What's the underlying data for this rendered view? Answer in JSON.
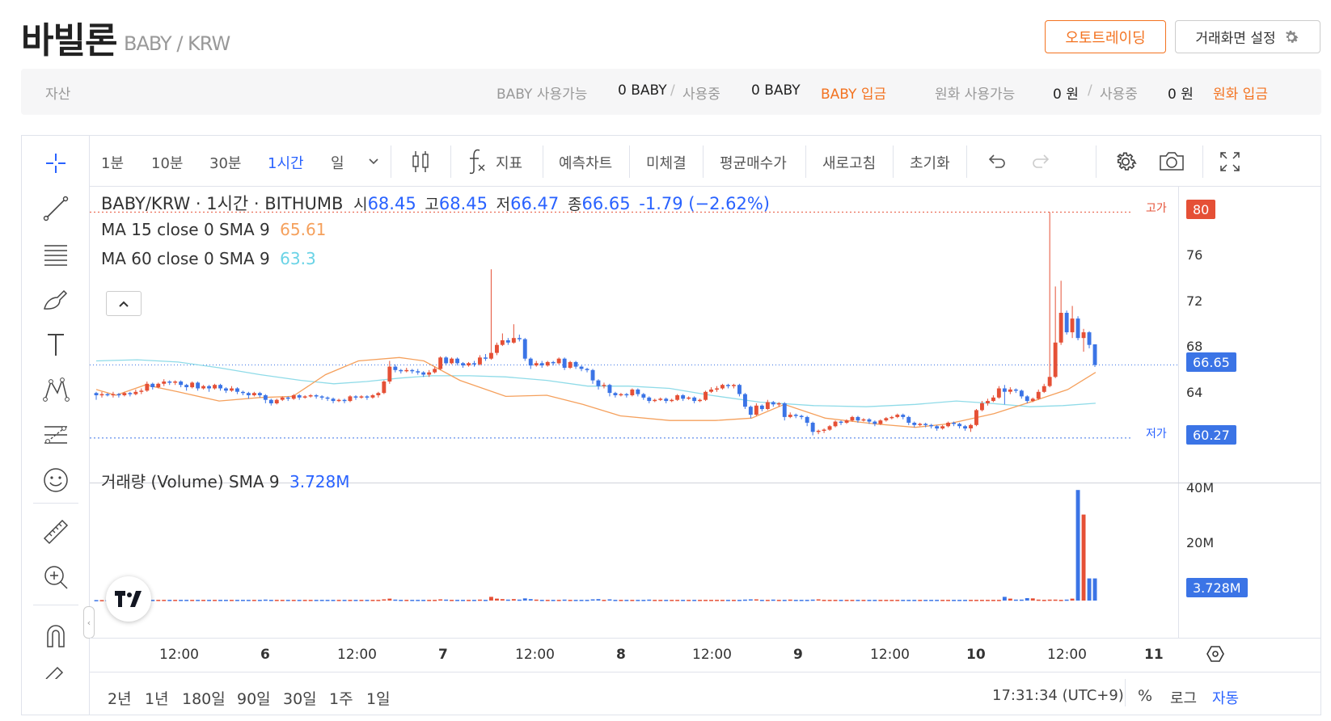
{
  "header": {
    "coin_name": "바빌론",
    "pair": "BABY / KRW",
    "auto_trading_label": "오토트레이딩",
    "screen_settings_label": "거래화면 설정"
  },
  "assets": {
    "label": "자산",
    "coin_available_label": "BABY 사용가능",
    "coin_available_value": "0 BABY",
    "in_use_label": "사용중",
    "coin_in_use_value": "0 BABY",
    "coin_deposit_link": "BABY 입금",
    "krw_available_label": "원화 사용가능",
    "krw_available_value": "0 원",
    "krw_in_use_value": "0 원",
    "krw_deposit_link": "원화 입금"
  },
  "toolbar": {
    "intervals": [
      "1분",
      "10분",
      "30분",
      "1시간",
      "일"
    ],
    "active_interval": "1시간",
    "indicators_label": "지표",
    "forecast_label": "예측차트",
    "unfilled_label": "미체결",
    "avg_price_label": "평균매수가",
    "refresh_label": "새로고침",
    "reset_label": "초기화"
  },
  "legend": {
    "main_title": "BABY/KRW · 1시간 · BITHUMB",
    "o_label": "시",
    "o_value": "68.45",
    "h_label": "고",
    "h_value": "68.45",
    "l_label": "저",
    "l_value": "66.47",
    "c_label": "종",
    "c_value": "66.65",
    "change": "-1.79 (−2.62%)",
    "ma15_label": "MA 15 close 0 SMA 9",
    "ma15_value": "65.61",
    "ma60_label": "MA 60 close 0 SMA 9",
    "ma60_value": "63.3",
    "volume_label": "거래량 (Volume) SMA 9",
    "volume_value": "3.728M"
  },
  "price_axis": {
    "ticks": [
      "76",
      "72",
      "68",
      "64"
    ],
    "high_label": "고가",
    "high_value": "80",
    "low_label": "저가",
    "low_value": "60.27",
    "last_value": "66.65"
  },
  "volume_axis": {
    "ticks": [
      "40M",
      "20M"
    ],
    "last_value": "3.728M"
  },
  "time_axis": {
    "ticks": [
      "12:00",
      "6",
      "12:00",
      "7",
      "12:00",
      "8",
      "12:00",
      "9",
      "12:00",
      "10",
      "12:00",
      "11"
    ]
  },
  "bottom_bar": {
    "ranges": [
      "2년",
      "1년",
      "180일",
      "90일",
      "30일",
      "1주",
      "1일"
    ],
    "clock": "17:31:34 (UTC+9)",
    "percent_label": "%",
    "log_label": "로그",
    "auto_label": "자동"
  },
  "colors": {
    "up": "#e55036",
    "down": "#3b74e6",
    "accent": "#f37321",
    "ma15": "#f5a05c",
    "ma60": "#8fdbe8"
  },
  "chart_data": {
    "type": "candlestick",
    "interval": "1h",
    "x_ticks": [
      "12:00",
      "6",
      "12:00",
      "7",
      "12:00",
      "8",
      "12:00",
      "9",
      "12:00",
      "10",
      "12:00",
      "11"
    ],
    "price_range": [
      58,
      82
    ],
    "volume_range": [
      0,
      50
    ],
    "volume_unit": "M",
    "candles": [
      [
        64.2,
        64.0,
        63.6,
        64.3
      ],
      [
        64.0,
        64.1,
        63.8,
        64.3
      ],
      [
        64.1,
        64.0,
        63.9,
        64.2
      ],
      [
        64.0,
        64.1,
        63.8,
        64.3
      ],
      [
        64.1,
        64.0,
        63.8,
        64.2
      ],
      [
        64.0,
        64.2,
        63.9,
        64.3
      ],
      [
        64.2,
        64.1,
        63.9,
        64.3
      ],
      [
        64.1,
        64.3,
        64.0,
        64.5
      ],
      [
        64.3,
        64.4,
        64.1,
        64.6
      ],
      [
        64.4,
        65.0,
        64.3,
        65.2
      ],
      [
        65.0,
        64.7,
        64.5,
        65.1
      ],
      [
        64.7,
        65.0,
        64.6,
        65.1
      ],
      [
        65.0,
        65.2,
        64.8,
        65.4
      ],
      [
        65.2,
        65.1,
        64.9,
        65.3
      ],
      [
        65.1,
        65.2,
        64.9,
        65.3
      ],
      [
        65.2,
        64.9,
        64.7,
        65.3
      ],
      [
        64.9,
        64.7,
        64.4,
        65.0
      ],
      [
        64.7,
        65.1,
        64.6,
        65.2
      ],
      [
        65.1,
        64.6,
        64.4,
        65.2
      ],
      [
        64.6,
        64.8,
        64.5,
        64.9
      ],
      [
        64.8,
        64.6,
        64.3,
        64.9
      ],
      [
        64.6,
        64.9,
        64.5,
        65.0
      ],
      [
        64.9,
        64.6,
        64.4,
        65.0
      ],
      [
        64.6,
        64.4,
        64.2,
        64.7
      ],
      [
        64.4,
        64.6,
        64.3,
        64.8
      ],
      [
        64.6,
        64.3,
        64.1,
        64.7
      ],
      [
        64.3,
        64.2,
        64.0,
        64.4
      ],
      [
        64.2,
        64.0,
        63.7,
        64.3
      ],
      [
        64.0,
        64.2,
        63.9,
        64.3
      ],
      [
        64.2,
        64.0,
        63.8,
        64.3
      ],
      [
        64.0,
        63.6,
        63.3,
        64.1
      ],
      [
        63.6,
        63.3,
        63.1,
        63.7
      ],
      [
        63.3,
        63.6,
        63.2,
        63.7
      ],
      [
        63.6,
        63.8,
        63.5,
        63.9
      ],
      [
        63.8,
        63.7,
        63.5,
        63.9
      ],
      [
        63.7,
        64.0,
        63.6,
        64.1
      ],
      [
        64.0,
        63.8,
        63.6,
        64.1
      ],
      [
        63.8,
        63.9,
        63.7,
        64.0
      ],
      [
        63.9,
        64.0,
        63.8,
        64.1
      ],
      [
        64.0,
        63.9,
        63.7,
        64.1
      ],
      [
        63.9,
        63.8,
        63.6,
        64.0
      ],
      [
        63.8,
        63.7,
        63.5,
        63.9
      ],
      [
        63.7,
        63.5,
        63.3,
        63.8
      ],
      [
        63.5,
        63.6,
        63.4,
        63.7
      ],
      [
        63.6,
        63.5,
        63.3,
        63.7
      ],
      [
        63.5,
        63.9,
        63.4,
        64.0
      ],
      [
        63.9,
        63.8,
        63.6,
        64.0
      ],
      [
        63.8,
        63.9,
        63.7,
        64.0
      ],
      [
        63.9,
        63.8,
        63.6,
        64.0
      ],
      [
        63.8,
        64.0,
        63.7,
        64.1
      ],
      [
        64.0,
        64.2,
        63.8,
        64.3
      ],
      [
        64.2,
        65.2,
        64.1,
        65.3
      ],
      [
        65.2,
        66.5,
        65.0,
        67.0
      ],
      [
        66.5,
        66.2,
        66.0,
        66.7
      ],
      [
        66.2,
        66.1,
        65.9,
        66.3
      ],
      [
        66.1,
        66.2,
        66.0,
        66.4
      ],
      [
        66.2,
        66.1,
        65.9,
        66.3
      ],
      [
        66.1,
        66.0,
        65.8,
        66.3
      ],
      [
        66.0,
        65.8,
        65.6,
        66.1
      ],
      [
        65.8,
        66.0,
        65.6,
        66.2
      ],
      [
        66.0,
        66.3,
        65.9,
        66.5
      ],
      [
        66.3,
        67.3,
        66.2,
        67.4
      ],
      [
        67.3,
        66.8,
        66.6,
        67.4
      ],
      [
        66.8,
        67.2,
        66.7,
        67.3
      ],
      [
        67.2,
        66.8,
        66.6,
        67.3
      ],
      [
        66.8,
        66.6,
        66.4,
        66.9
      ],
      [
        66.6,
        66.8,
        66.5,
        66.9
      ],
      [
        66.8,
        66.7,
        66.5,
        67.0
      ],
      [
        66.7,
        67.3,
        66.6,
        67.5
      ],
      [
        67.3,
        67.2,
        67.0,
        67.6
      ],
      [
        67.2,
        67.7,
        67.1,
        75.0
      ],
      [
        67.7,
        68.4,
        67.5,
        68.6
      ],
      [
        68.4,
        68.8,
        68.3,
        69.4
      ],
      [
        68.8,
        68.6,
        68.4,
        69.0
      ],
      [
        68.6,
        69.0,
        68.5,
        70.2
      ],
      [
        69.0,
        68.9,
        68.7,
        69.3
      ],
      [
        68.9,
        67.2,
        67.0,
        69.0
      ],
      [
        67.2,
        66.6,
        66.3,
        67.3
      ],
      [
        66.6,
        66.8,
        66.5,
        67.0
      ],
      [
        66.8,
        66.6,
        66.4,
        67.0
      ],
      [
        66.6,
        66.9,
        66.5,
        67.0
      ],
      [
        66.9,
        66.8,
        66.6,
        67.0
      ],
      [
        66.8,
        67.2,
        66.7,
        67.3
      ],
      [
        67.2,
        66.4,
        66.2,
        67.3
      ],
      [
        66.4,
        66.9,
        66.3,
        67.0
      ],
      [
        66.9,
        66.5,
        66.3,
        67.0
      ],
      [
        66.5,
        66.3,
        66.1,
        66.6
      ],
      [
        66.3,
        66.2,
        66.0,
        66.4
      ],
      [
        66.2,
        65.3,
        65.0,
        66.3
      ],
      [
        65.3,
        64.8,
        64.5,
        65.4
      ],
      [
        64.8,
        64.9,
        64.6,
        65.1
      ],
      [
        64.9,
        64.2,
        63.9,
        65.0
      ],
      [
        64.2,
        64.0,
        63.8,
        64.3
      ],
      [
        64.0,
        64.1,
        63.9,
        64.2
      ],
      [
        64.1,
        64.0,
        63.8,
        64.2
      ],
      [
        64.0,
        64.5,
        63.9,
        64.6
      ],
      [
        64.5,
        64.1,
        63.9,
        64.6
      ],
      [
        64.1,
        63.8,
        63.6,
        64.2
      ],
      [
        63.8,
        63.5,
        63.3,
        63.9
      ],
      [
        63.5,
        63.6,
        63.4,
        63.7
      ],
      [
        63.6,
        63.7,
        63.5,
        63.8
      ],
      [
        63.7,
        63.5,
        63.3,
        63.8
      ],
      [
        63.5,
        63.6,
        63.4,
        63.7
      ],
      [
        63.6,
        64.0,
        63.5,
        64.1
      ],
      [
        64.0,
        63.7,
        63.5,
        64.1
      ],
      [
        63.7,
        63.8,
        63.6,
        63.9
      ],
      [
        63.8,
        63.5,
        63.3,
        63.9
      ],
      [
        63.5,
        63.6,
        63.4,
        63.7
      ],
      [
        63.6,
        64.3,
        63.5,
        64.4
      ],
      [
        64.3,
        64.5,
        64.2,
        64.7
      ],
      [
        64.5,
        64.6,
        64.3,
        64.8
      ],
      [
        64.6,
        64.9,
        64.5,
        65.0
      ],
      [
        64.9,
        64.8,
        64.6,
        65.0
      ],
      [
        64.8,
        64.9,
        64.6,
        65.0
      ],
      [
        64.9,
        64.1,
        63.9,
        65.0
      ],
      [
        64.1,
        63.0,
        62.8,
        64.2
      ],
      [
        63.0,
        62.3,
        62.0,
        63.1
      ],
      [
        62.3,
        63.1,
        62.2,
        63.3
      ],
      [
        63.1,
        62.8,
        62.6,
        63.2
      ],
      [
        62.8,
        63.4,
        62.7,
        63.6
      ],
      [
        63.4,
        63.2,
        63.0,
        63.5
      ],
      [
        63.2,
        63.3,
        63.0,
        63.4
      ],
      [
        63.3,
        62.1,
        61.8,
        63.4
      ],
      [
        62.1,
        62.3,
        62.0,
        62.5
      ],
      [
        62.3,
        62.2,
        62.0,
        62.4
      ],
      [
        62.2,
        62.1,
        61.9,
        62.3
      ],
      [
        62.1,
        61.6,
        61.3,
        62.2
      ],
      [
        61.6,
        60.8,
        60.5,
        61.7
      ],
      [
        60.8,
        60.9,
        60.6,
        61.0
      ],
      [
        60.9,
        61.0,
        60.7,
        61.1
      ],
      [
        61.0,
        61.3,
        60.9,
        61.4
      ],
      [
        61.3,
        61.7,
        61.2,
        61.8
      ],
      [
        61.7,
        61.6,
        61.4,
        61.8
      ],
      [
        61.6,
        61.8,
        61.5,
        61.9
      ],
      [
        61.8,
        62.1,
        61.7,
        62.2
      ],
      [
        62.1,
        61.8,
        61.6,
        62.2
      ],
      [
        61.8,
        61.9,
        61.7,
        62.0
      ],
      [
        61.9,
        61.7,
        61.5,
        62.0
      ],
      [
        61.7,
        61.5,
        61.3,
        61.8
      ],
      [
        61.5,
        61.8,
        61.4,
        61.9
      ],
      [
        61.8,
        62.0,
        61.7,
        62.1
      ],
      [
        62.0,
        62.1,
        61.9,
        62.2
      ],
      [
        62.1,
        62.3,
        62.0,
        62.4
      ],
      [
        62.3,
        62.1,
        61.9,
        62.4
      ],
      [
        62.1,
        61.6,
        61.4,
        62.2
      ],
      [
        61.6,
        61.4,
        61.2,
        61.7
      ],
      [
        61.4,
        61.5,
        61.3,
        61.6
      ],
      [
        61.5,
        61.4,
        61.2,
        61.6
      ],
      [
        61.4,
        61.3,
        61.1,
        61.5
      ],
      [
        61.3,
        61.1,
        60.9,
        61.4
      ],
      [
        61.1,
        61.3,
        61.0,
        61.4
      ],
      [
        61.3,
        61.6,
        61.2,
        61.7
      ],
      [
        61.6,
        61.5,
        61.3,
        61.7
      ],
      [
        61.5,
        61.3,
        61.1,
        61.6
      ],
      [
        61.3,
        61.1,
        60.9,
        61.4
      ],
      [
        61.1,
        61.4,
        60.8,
        61.5
      ],
      [
        61.4,
        62.7,
        61.3,
        62.8
      ],
      [
        62.7,
        63.3,
        62.6,
        63.5
      ],
      [
        63.3,
        63.5,
        63.1,
        63.7
      ],
      [
        63.5,
        63.8,
        63.4,
        64.0
      ],
      [
        63.8,
        64.6,
        63.7,
        64.8
      ],
      [
        64.6,
        64.3,
        63.2,
        64.9
      ],
      [
        64.3,
        64.5,
        64.1,
        64.7
      ],
      [
        64.5,
        64.4,
        64.2,
        64.6
      ],
      [
        64.4,
        63.9,
        63.7,
        64.5
      ],
      [
        63.9,
        63.5,
        63.3,
        64.0
      ],
      [
        63.5,
        63.7,
        63.4,
        63.8
      ],
      [
        63.7,
        64.3,
        63.6,
        64.5
      ],
      [
        64.3,
        64.8,
        64.2,
        65.0
      ],
      [
        64.8,
        65.6,
        64.7,
        80.0
      ],
      [
        65.6,
        68.6,
        65.5,
        73.5
      ],
      [
        68.6,
        71.2,
        68.4,
        74.0
      ],
      [
        71.2,
        69.5,
        69.3,
        71.4
      ],
      [
        69.5,
        70.7,
        69.0,
        71.8
      ],
      [
        70.7,
        69.0,
        68.8,
        70.9
      ],
      [
        69.0,
        69.5,
        67.8,
        69.8
      ],
      [
        69.5,
        68.4,
        68.1,
        69.6
      ],
      [
        68.45,
        66.65,
        66.47,
        68.45
      ]
    ],
    "volumes_M": [
      0.2,
      0.2,
      0.2,
      0.2,
      0.2,
      0.2,
      0.2,
      0.2,
      0.3,
      0.4,
      0.3,
      0.3,
      0.3,
      0.3,
      0.3,
      0.3,
      0.3,
      0.3,
      0.3,
      0.3,
      0.3,
      0.3,
      0.3,
      0.3,
      0.3,
      0.3,
      0.3,
      0.3,
      0.3,
      0.3,
      0.4,
      0.3,
      0.3,
      0.3,
      0.3,
      0.3,
      0.3,
      0.3,
      0.3,
      0.3,
      0.3,
      0.3,
      0.3,
      0.3,
      0.3,
      0.3,
      0.3,
      0.3,
      0.3,
      0.3,
      0.3,
      0.5,
      0.8,
      0.4,
      0.3,
      0.3,
      0.3,
      0.3,
      0.3,
      0.3,
      0.3,
      0.5,
      0.4,
      0.3,
      0.3,
      0.3,
      0.3,
      0.3,
      0.4,
      0.3,
      1.5,
      0.8,
      0.6,
      0.4,
      0.6,
      0.4,
      0.9,
      0.6,
      0.4,
      0.3,
      0.3,
      0.3,
      0.3,
      0.4,
      0.3,
      0.3,
      0.3,
      0.3,
      0.5,
      0.6,
      0.3,
      0.5,
      0.3,
      0.3,
      0.3,
      0.3,
      0.3,
      0.3,
      0.4,
      0.3,
      0.3,
      0.3,
      0.3,
      0.3,
      0.3,
      0.3,
      0.3,
      0.3,
      0.3,
      0.3,
      0.3,
      0.3,
      0.3,
      0.3,
      0.3,
      0.4,
      0.5,
      0.5,
      0.3,
      0.3,
      0.4,
      0.3,
      0.3,
      0.4,
      0.3,
      0.3,
      0.3,
      0.4,
      0.5,
      0.3,
      0.3,
      0.3,
      0.3,
      0.3,
      0.3,
      0.3,
      0.3,
      0.3,
      0.3,
      0.3,
      0.3,
      0.3,
      0.3,
      0.3,
      0.3,
      0.3,
      0.3,
      0.3,
      0.3,
      0.3,
      0.3,
      0.3,
      0.3,
      0.3,
      0.3,
      0.3,
      0.3,
      0.3,
      0.3,
      0.3,
      0.3,
      1.5,
      0.8,
      0.4,
      0.4,
      1.0,
      0.9,
      0.4,
      0.3,
      0.4,
      0.4,
      0.3,
      0.4,
      0.8,
      45.0,
      35.0,
      9.0,
      9.0,
      9.0,
      7.0,
      3.728,
      3.728
    ],
    "ma15": [
      [
        0,
        64.5
      ],
      [
        12,
        64.0
      ],
      [
        30,
        64.9
      ],
      [
        50,
        64.3
      ],
      [
        75,
        63.5
      ],
      [
        100,
        63.8
      ],
      [
        120,
        63.9
      ],
      [
        140,
        65.8
      ],
      [
        160,
        67.0
      ],
      [
        185,
        67.3
      ],
      [
        200,
        67.0
      ],
      [
        222,
        65.3
      ],
      [
        250,
        63.9
      ],
      [
        275,
        64.0
      ],
      [
        297,
        63.2
      ],
      [
        320,
        62.2
      ],
      [
        350,
        61.8
      ],
      [
        378,
        61.8
      ],
      [
        400,
        62.0
      ],
      [
        420,
        63.2
      ],
      [
        445,
        62.0
      ],
      [
        475,
        61.5
      ],
      [
        500,
        61.2
      ],
      [
        520,
        61.5
      ],
      [
        548,
        62.4
      ],
      [
        570,
        63.4
      ],
      [
        593,
        64.5
      ],
      [
        610,
        66.0
      ]
    ],
    "ma60": [
      [
        0,
        67.0
      ],
      [
        25,
        67.1
      ],
      [
        50,
        66.9
      ],
      [
        75,
        66.4
      ],
      [
        100,
        65.8
      ],
      [
        125,
        65.3
      ],
      [
        145,
        65.0
      ],
      [
        165,
        65.2
      ],
      [
        185,
        65.5
      ],
      [
        205,
        65.7
      ],
      [
        228,
        65.7
      ],
      [
        250,
        65.6
      ],
      [
        275,
        65.3
      ],
      [
        300,
        64.8
      ],
      [
        325,
        64.8
      ],
      [
        350,
        64.6
      ],
      [
        375,
        64.0
      ],
      [
        405,
        63.4
      ],
      [
        438,
        63.1
      ],
      [
        470,
        63.0
      ],
      [
        500,
        63.2
      ],
      [
        525,
        63.5
      ],
      [
        545,
        63.3
      ],
      [
        570,
        63.0
      ],
      [
        590,
        63.1
      ],
      [
        610,
        63.3
      ]
    ]
  }
}
